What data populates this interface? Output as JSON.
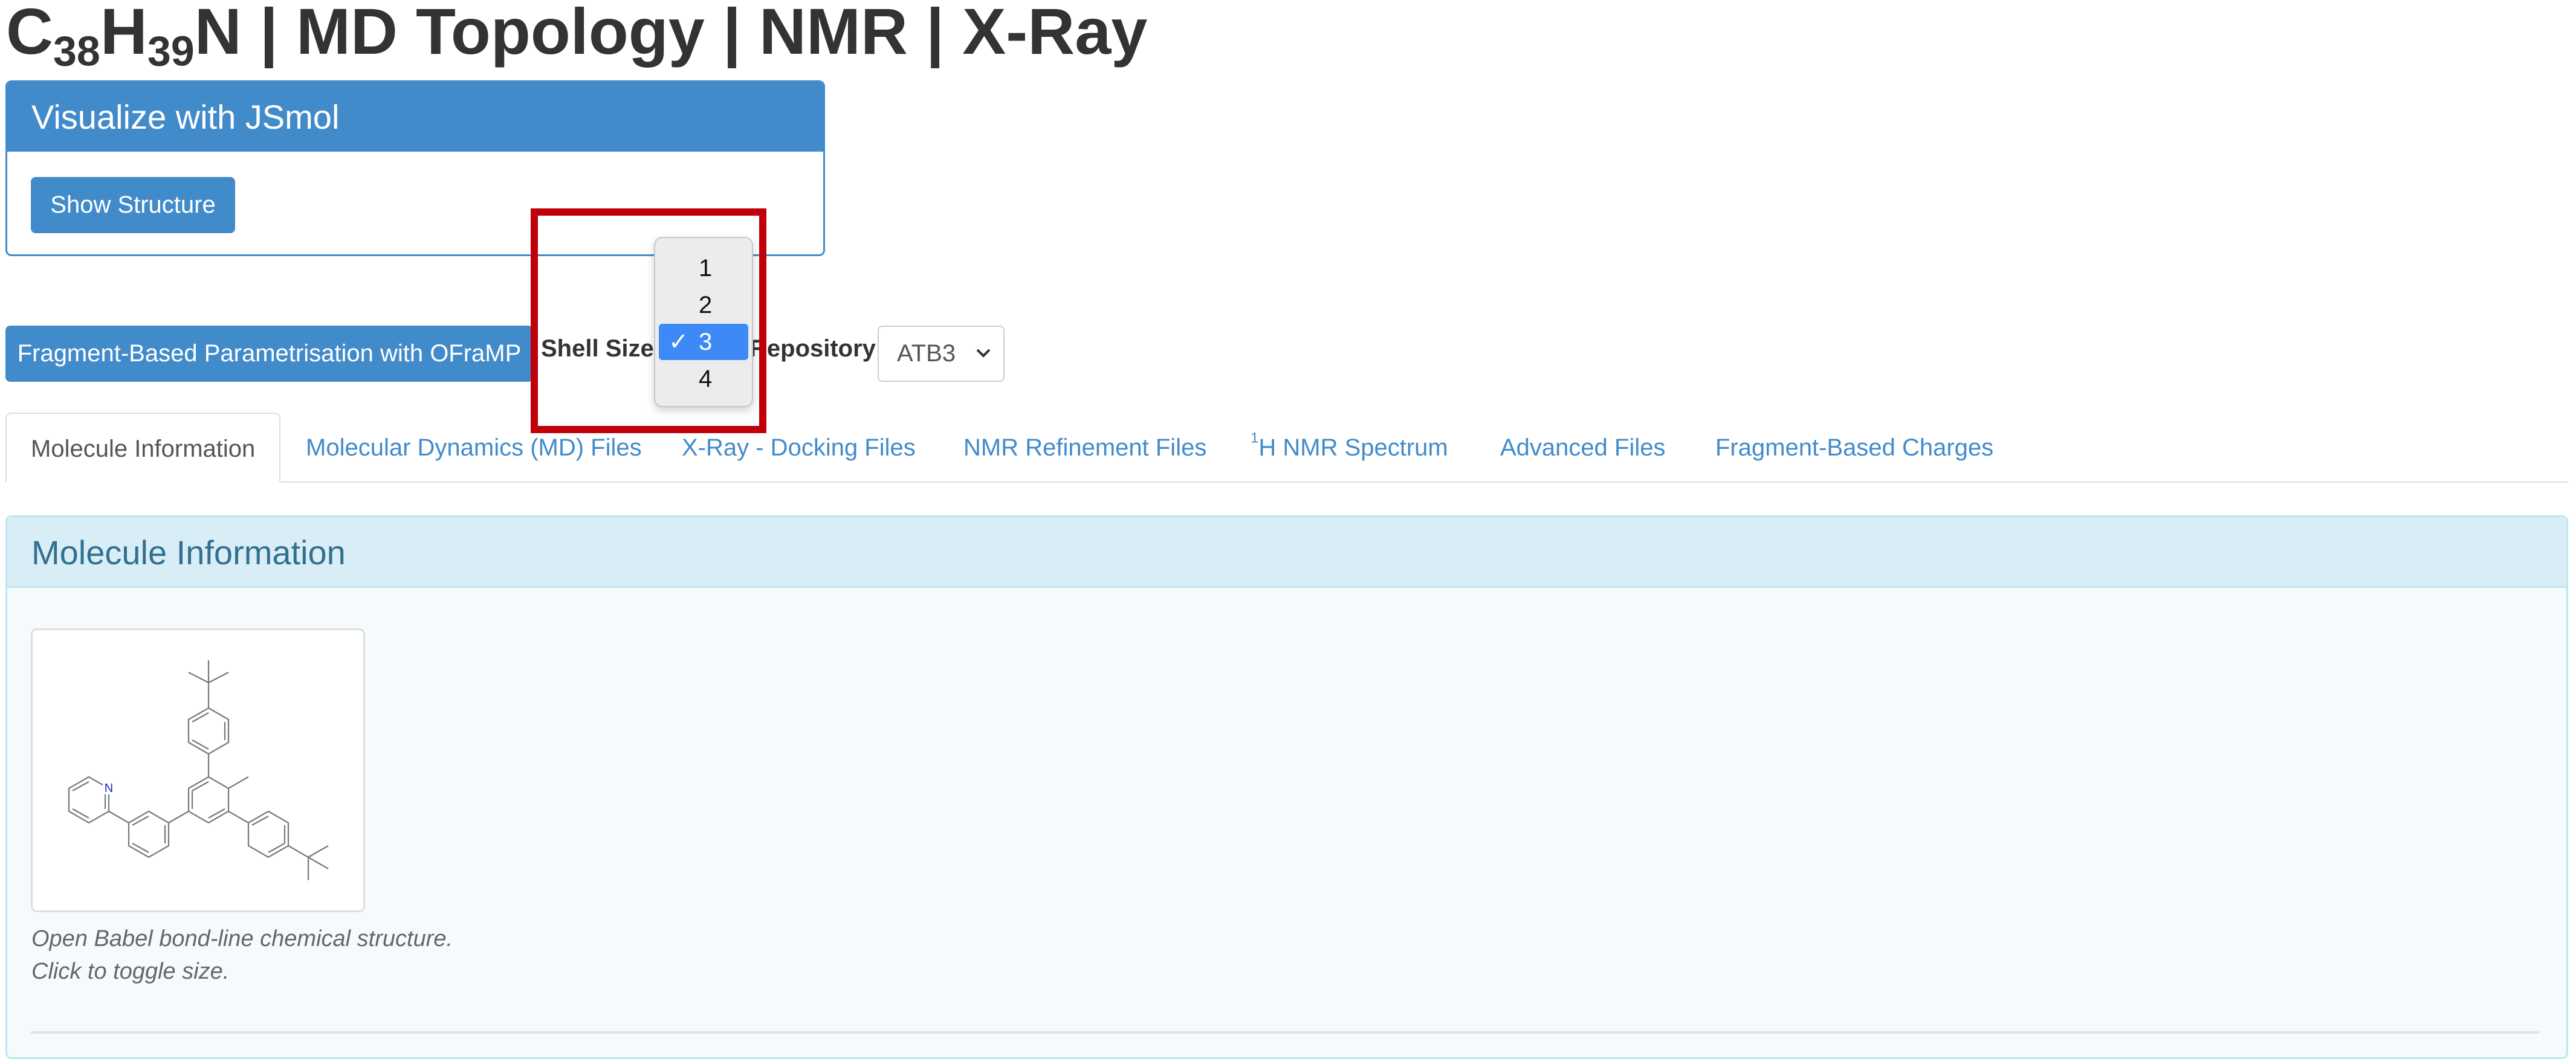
{
  "page_title": {
    "formula": {
      "c": "C",
      "c_count": "38",
      "h": "H",
      "h_count": "39",
      "n": "N"
    },
    "rest": " | MD Topology | NMR | X-Ray"
  },
  "jsmol_panel": {
    "heading": "Visualize with JSmol",
    "show_structure_label": "Show Structure"
  },
  "oframp": {
    "button_label": "Fragment-Based Parametrisation with OFraMP",
    "shell_size_label": "Shell Size",
    "shell_size_options": [
      "1",
      "2",
      "3",
      "4"
    ],
    "shell_size_selected": "3",
    "repository_label": "Repository",
    "repository_value": "ATB3"
  },
  "tabs": [
    {
      "label": "Molecule Information",
      "active": true
    },
    {
      "label": "Molecular Dynamics (MD) Files"
    },
    {
      "label": "X-Ray - Docking Files"
    },
    {
      "label": "NMR Refinement Files"
    },
    {
      "sup": "1",
      "label": "H NMR Spectrum"
    },
    {
      "label": "Advanced Files"
    },
    {
      "label": "Fragment-Based Charges"
    }
  ],
  "info_panel": {
    "heading": "Molecule Information",
    "structure_atom_label": "N",
    "caption_line1": "Open Babel bond-line chemical structure.",
    "caption_line2": "Click to toggle size."
  },
  "colors": {
    "primary": "#428bca",
    "highlight": "#c0000b",
    "dropdown_selected": "#3d8af7",
    "info_heading_bg": "#d9edf7",
    "info_heading_text": "#31708f"
  }
}
